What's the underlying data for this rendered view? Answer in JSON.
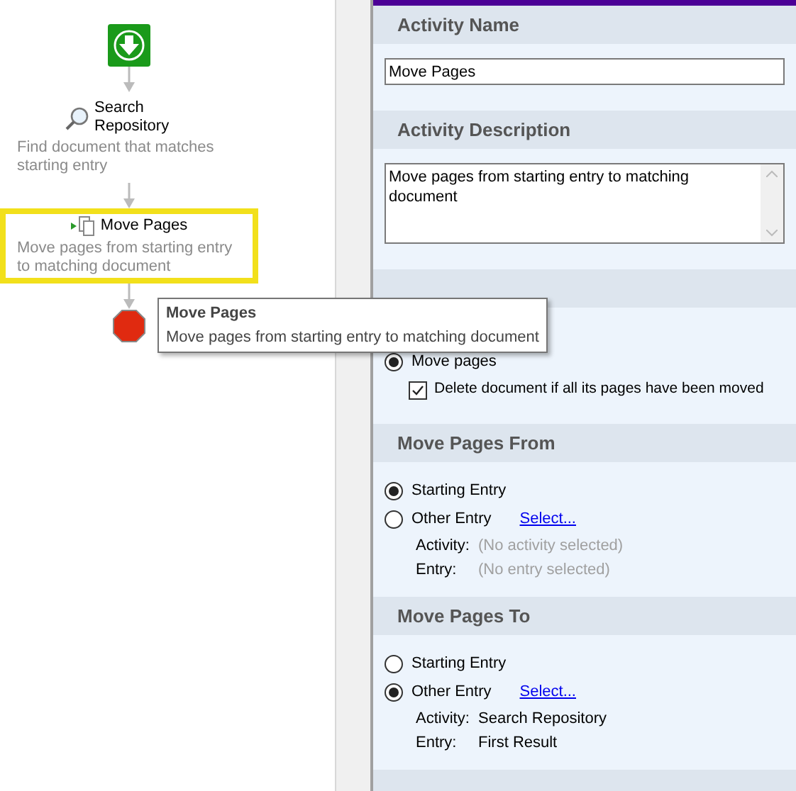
{
  "workflow": {
    "nodes": [
      {
        "kind": "start"
      },
      {
        "kind": "search",
        "title": "Search Repository",
        "description": "Find document that matches starting entry",
        "selected": false
      },
      {
        "kind": "move",
        "title": "Move Pages",
        "description": "Move pages from starting entry to matching document",
        "selected": true
      },
      {
        "kind": "stop"
      }
    ],
    "tooltip": {
      "title": "Move Pages",
      "text": "Move pages from starting entry to matching document"
    }
  },
  "properties": {
    "sections": [
      {
        "kind": "text",
        "title": "Activity Name",
        "value": "Move Pages"
      },
      {
        "kind": "textarea",
        "title": "Activity Description",
        "value": "Move pages from starting entry to matching document"
      },
      {
        "kind": "action",
        "options": [
          {
            "label": "Move pages",
            "selected": true
          }
        ],
        "checkbox": {
          "label": "Delete document if all its pages have been moved",
          "checked": true
        }
      },
      {
        "kind": "entry",
        "title": "Move Pages From",
        "options": [
          {
            "label": "Starting Entry",
            "selected": true
          },
          {
            "label": "Other Entry",
            "selected": false
          }
        ],
        "link": "Select...",
        "fields": [
          {
            "label": "Activity:",
            "value": "(No activity selected)",
            "empty": true
          },
          {
            "label": "Entry:",
            "value": "(No entry selected)",
            "empty": true
          }
        ]
      },
      {
        "kind": "entry",
        "title": "Move Pages To",
        "options": [
          {
            "label": "Starting Entry",
            "selected": false
          },
          {
            "label": "Other Entry",
            "selected": true
          }
        ],
        "link": "Select...",
        "fields": [
          {
            "label": "Activity:",
            "value": "Search Repository",
            "empty": false
          },
          {
            "label": "Entry:",
            "value": "First Result",
            "empty": false
          }
        ]
      }
    ]
  }
}
